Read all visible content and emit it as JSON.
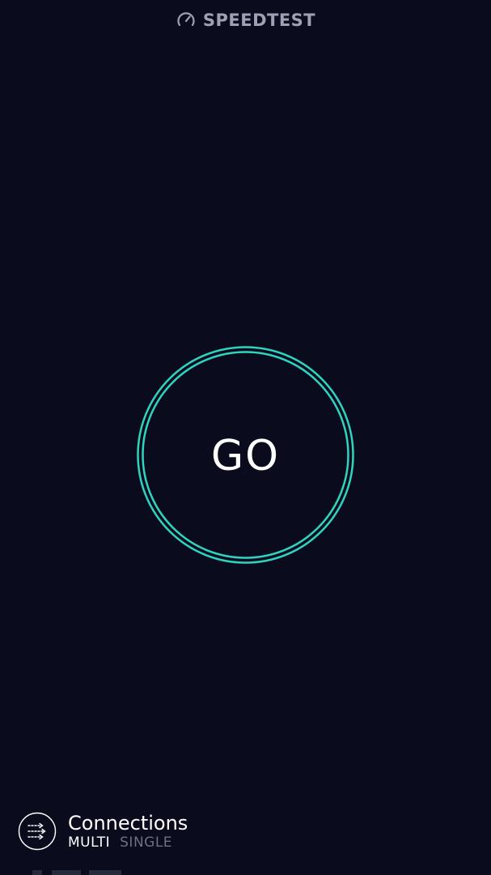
{
  "header": {
    "brand": "SPEEDTEST",
    "icon": "speedometer-icon"
  },
  "go_button": {
    "label": "GO"
  },
  "connections": {
    "icon": "connections-arrows-icon",
    "title": "Connections",
    "options": [
      {
        "label": "MULTI",
        "selected": true
      },
      {
        "label": "SINGLE",
        "selected": false
      }
    ]
  },
  "colors": {
    "background": "#0a0c1e",
    "accent": "#2fd4c0",
    "brand_text": "#9ea1b4",
    "inactive_text": "#6d7085"
  }
}
